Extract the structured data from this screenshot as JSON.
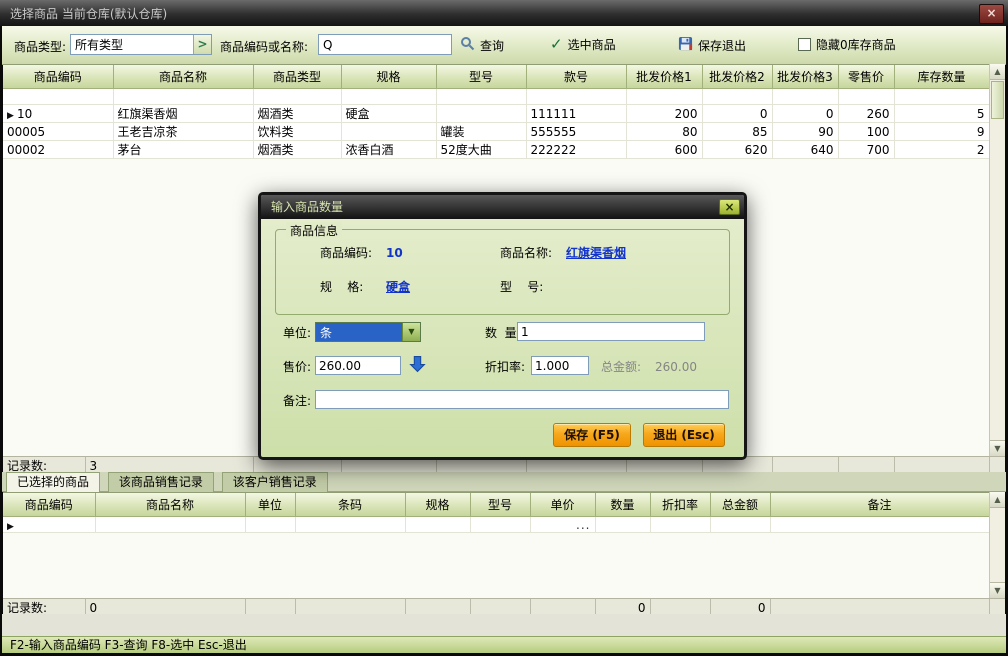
{
  "window": {
    "title": "选择商品 当前仓库(默认仓库)",
    "close": "×"
  },
  "toolbar": {
    "type_label": "商品类型:",
    "type_value": "所有类型",
    "code_label": "商品编码或名称:",
    "code_value": "Q",
    "search_label": "查询",
    "select_label": "选中商品",
    "save_exit_label": "保存退出",
    "hide_zero_label": "隐藏0库存商品"
  },
  "main_grid": {
    "columns": [
      "商品编码",
      "商品名称",
      "商品类型",
      "规格",
      "型号",
      "款号",
      "批发价格1",
      "批发价格2",
      "批发价格3",
      "零售价",
      "库存数量"
    ],
    "rows": [
      [
        "10",
        "红旗渠香烟",
        "烟酒类",
        "硬盒",
        "",
        "111111",
        "200",
        "0",
        "0",
        "260",
        "5"
      ],
      [
        "00005",
        "王老吉凉茶",
        "饮料类",
        "",
        "罐装",
        "555555",
        "80",
        "85",
        "90",
        "100",
        "9"
      ],
      [
        "00002",
        "茅台",
        "烟酒类",
        "浓香白酒",
        "52度大曲",
        "222222",
        "600",
        "620",
        "640",
        "700",
        "2"
      ]
    ],
    "footer_label": "记录数:",
    "footer_count": "3"
  },
  "tabs": {
    "selected": "已选择的商品",
    "product_sales": "该商品销售记录",
    "customer_sales": "该客户销售记录"
  },
  "selected_grid": {
    "columns": [
      "商品编码",
      "商品名称",
      "单位",
      "条码",
      "规格",
      "型号",
      "单价",
      "数量",
      "折扣率",
      "总金额",
      "备注"
    ],
    "ellipsis": "...",
    "footer_label": "记录数:",
    "footer_count": "0",
    "footer_qty": "0",
    "footer_total": "0"
  },
  "dialog": {
    "title": "输入商品数量",
    "close": "×",
    "info": {
      "legend": "商品信息",
      "code_label": "商品编码:",
      "code_value": "10",
      "name_label": "商品名称:",
      "name_value": "红旗渠香烟",
      "spec_label": "规    格:",
      "spec_value": "硬盒",
      "model_label": "型    号:"
    },
    "unit_label": "单位:",
    "unit_value": "条",
    "qty_label": "数  量:",
    "qty_value": "1",
    "price_label": "售价:",
    "price_value": "260.00",
    "discount_label": "折扣率:",
    "discount_value": "1.000",
    "total_label": "总金额:",
    "total_value": "260.00",
    "remark_label": "备注:",
    "remark_value": "",
    "save_button": "保存 (F5)",
    "exit_button": "退出 (Esc)"
  },
  "statusbar": {
    "text": "F2-输入商品编码 F3-查询 F8-选中 Esc-退出"
  }
}
